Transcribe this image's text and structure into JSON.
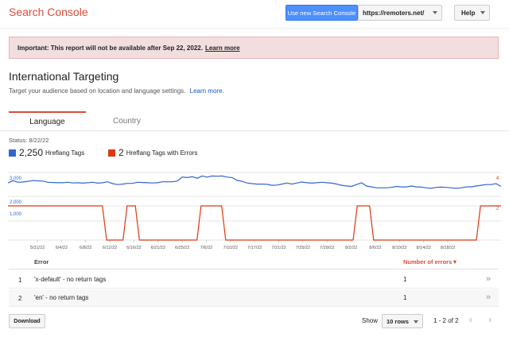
{
  "header": {
    "app_title": "Search Console",
    "new_sc_button": "Use new Search Console",
    "site": "https://remoters.net/",
    "help": "Help"
  },
  "banner": {
    "text": "Important: This report will not be available after Sep 22, 2022.",
    "link": "Learn more"
  },
  "page": {
    "title": "International Targeting",
    "subtitle": "Target your audience based on location and language settings.",
    "subtitle_link": "Learn more."
  },
  "tabs": [
    {
      "label": "Language",
      "active": true
    },
    {
      "label": "Country",
      "active": false
    }
  ],
  "status": "Status: 8/22/22",
  "legend": [
    {
      "count": "2,250",
      "label": "Hreflang Tags",
      "color": "#3366cc"
    },
    {
      "count": "2",
      "label": "Hreflang Tags with Errors",
      "color": "#dc3912"
    }
  ],
  "chart_data": {
    "type": "line",
    "x_ticks": [
      "5/31/22",
      "6/4/22",
      "6/8/22",
      "6/12/22",
      "6/16/22",
      "6/21/22",
      "6/25/22",
      "7/6/22",
      "7/10/22",
      "7/17/22",
      "7/21/22",
      "7/25/22",
      "7/29/22",
      "8/2/22",
      "8/6/22",
      "8/10/22",
      "8/14/22",
      "8/18/22"
    ],
    "y_left_ticks": [
      "3,000",
      "2,000",
      "1,000"
    ],
    "y_right_ticks": [
      "4",
      "2"
    ],
    "series": [
      {
        "name": "Hreflang Tags",
        "color": "#3366cc",
        "axis": "left",
        "values": [
          2850,
          2950,
          2880,
          2890,
          2920,
          2950,
          2940,
          2930,
          2880,
          2870,
          2860,
          2860,
          2880,
          2850,
          2860,
          2840,
          2860,
          2880,
          2840,
          2860,
          2900,
          2820,
          2780,
          2800,
          2830,
          2830,
          2880,
          2870,
          2860,
          2850,
          2860,
          2900,
          2900,
          2900,
          2930,
          3100,
          3080,
          3120,
          3050,
          3150,
          3100,
          3150,
          3140,
          3150,
          3100,
          3080,
          2960,
          2920,
          2850,
          2820,
          2800,
          2800,
          2790,
          2750,
          2760,
          2800,
          2850,
          2800,
          2850,
          2890,
          2860,
          2840,
          2860,
          2880,
          2860,
          2840,
          2800,
          2750,
          2720,
          2700,
          2780,
          2860,
          2720,
          2680,
          2640,
          2640,
          2640,
          2660,
          2700,
          2680,
          2680,
          2720,
          2680,
          2670,
          2640,
          2620,
          2660,
          2670,
          2660,
          2640,
          2620,
          2640,
          2680,
          2680,
          2720,
          2750,
          2780,
          2780,
          2820,
          2700
        ]
      },
      {
        "name": "Hreflang Tags with Errors",
        "color": "#dc3912",
        "axis": "right",
        "values": [
          2,
          2,
          2,
          2,
          2,
          2,
          2,
          2,
          2,
          2,
          2,
          2,
          2,
          2,
          2,
          2,
          2,
          2,
          2,
          2,
          2,
          2,
          2,
          2,
          0,
          0,
          0,
          0,
          0,
          2,
          2,
          2,
          0,
          0,
          0,
          0,
          0,
          0,
          0,
          0,
          0,
          0,
          0,
          0,
          0,
          0,
          0,
          2,
          2,
          2,
          2,
          2,
          2,
          0,
          0,
          0,
          0,
          0,
          0,
          0,
          0,
          0,
          0,
          0,
          0,
          0,
          0,
          0,
          0,
          0,
          0,
          0,
          0,
          0,
          0,
          0,
          0,
          0,
          0,
          0,
          0,
          0,
          0,
          0,
          0,
          2,
          2,
          2,
          2,
          0,
          0,
          0,
          0,
          0,
          0,
          0,
          0,
          0,
          0,
          0,
          0,
          0,
          0,
          0,
          0,
          0,
          0,
          0,
          0,
          0,
          0,
          0,
          0,
          0,
          0,
          2,
          2,
          2,
          2,
          2,
          2
        ]
      }
    ]
  },
  "table": {
    "headers": {
      "error": "Error",
      "count": "Number of errors▼"
    },
    "rows": [
      {
        "index": "1",
        "error": "'x-default' - no return tags",
        "count": "1"
      },
      {
        "index": "2",
        "error": "'en' - no return tags",
        "count": "1"
      }
    ]
  },
  "footer": {
    "download": "Download",
    "show": "Show",
    "rows_per_page": "10 rows",
    "range": "1 - 2 of 2",
    "prev_icon": "chevron-left-icon",
    "next_icon": "chevron-right-icon"
  }
}
